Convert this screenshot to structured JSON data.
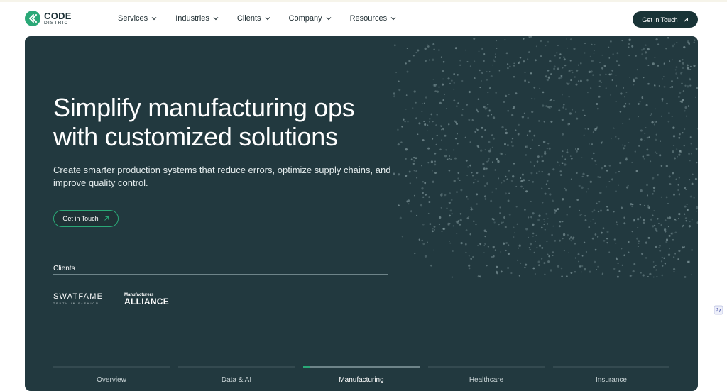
{
  "brand": {
    "name": "CODE",
    "subtitle": "DISTRICT"
  },
  "nav": {
    "items": [
      {
        "label": "Services",
        "icon": "chevron-down-icon"
      },
      {
        "label": "Industries",
        "icon": "chevron-down-icon"
      },
      {
        "label": "Clients",
        "icon": "chevron-down-icon"
      },
      {
        "label": "Company",
        "icon": "chevron-down-icon"
      },
      {
        "label": "Resources",
        "icon": "chevron-down-icon"
      }
    ],
    "cta_label": "Get in Touch",
    "cta_icon": "arrow-up-right-icon"
  },
  "hero": {
    "title_line1": "Simplify manufacturing ops",
    "title_line2": "with customized solutions",
    "subtitle": "Create smarter production systems that reduce errors, optimize supply chains, and improve quality control.",
    "cta_label": "Get in Touch",
    "cta_icon": "arrow-up-right-icon"
  },
  "clients": {
    "label": "Clients",
    "logos": [
      {
        "name": "SWATFAME",
        "tagline": "TRUTH IN FASHION"
      },
      {
        "name_small": "Manufacturers",
        "name_big": "ALLIANCE"
      }
    ]
  },
  "tabs": {
    "items": [
      {
        "label": "Overview",
        "progress": 0
      },
      {
        "label": "Data & AI",
        "progress": 0
      },
      {
        "label": "Manufacturing",
        "progress": 0.06,
        "active": true
      },
      {
        "label": "Healthcare",
        "progress": 0
      },
      {
        "label": "Insurance",
        "progress": 0
      }
    ]
  },
  "colors": {
    "accent": "#2aa877",
    "hero_bg": "#22393f",
    "nav_cta_bg": "#193437"
  }
}
